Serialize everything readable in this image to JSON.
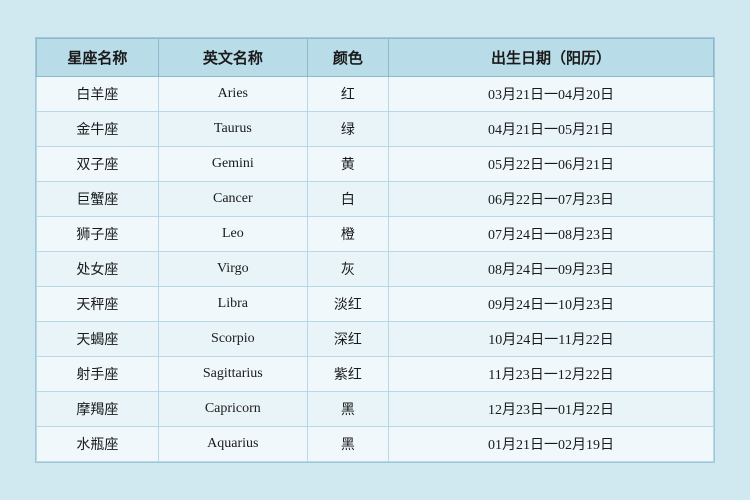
{
  "table": {
    "headers": [
      "星座名称",
      "英文名称",
      "颜色",
      "出生日期（阳历）"
    ],
    "rows": [
      {
        "cn": "白羊座",
        "en": "Aries",
        "color": "红",
        "date": "03月21日一04月20日"
      },
      {
        "cn": "金牛座",
        "en": "Taurus",
        "color": "绿",
        "date": "04月21日一05月21日"
      },
      {
        "cn": "双子座",
        "en": "Gemini",
        "color": "黄",
        "date": "05月22日一06月21日"
      },
      {
        "cn": "巨蟹座",
        "en": "Cancer",
        "color": "白",
        "date": "06月22日一07月23日"
      },
      {
        "cn": "狮子座",
        "en": "Leo",
        "color": "橙",
        "date": "07月24日一08月23日"
      },
      {
        "cn": "处女座",
        "en": "Virgo",
        "color": "灰",
        "date": "08月24日一09月23日"
      },
      {
        "cn": "天秤座",
        "en": "Libra",
        "color": "淡红",
        "date": "09月24日一10月23日"
      },
      {
        "cn": "天蝎座",
        "en": "Scorpio",
        "color": "深红",
        "date": "10月24日一11月22日"
      },
      {
        "cn": "射手座",
        "en": "Sagittarius",
        "color": "紫红",
        "date": "11月23日一12月22日"
      },
      {
        "cn": "摩羯座",
        "en": "Capricorn",
        "color": "黑",
        "date": "12月23日一01月22日"
      },
      {
        "cn": "水瓶座",
        "en": "Aquarius",
        "color": "黑",
        "date": "01月21日一02月19日"
      }
    ]
  }
}
